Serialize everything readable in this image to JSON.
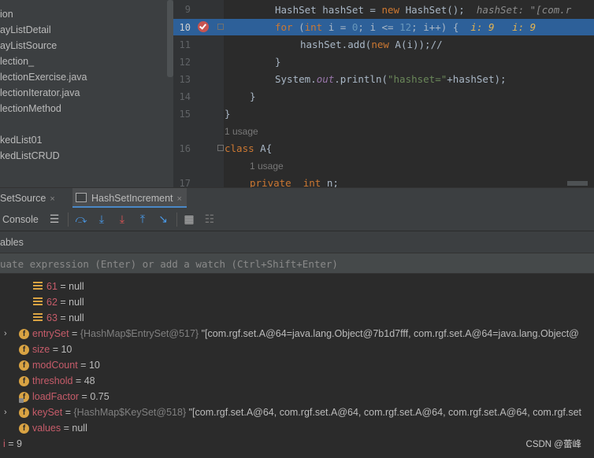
{
  "project_tree": {
    "items": [
      "ion",
      "ayListDetail",
      "ayListSource",
      "lection_",
      "lectionExercise.java",
      "lectionIterator.java",
      "lectionMethod",
      "kedList01",
      "kedListCRUD"
    ]
  },
  "editor": {
    "line_numbers": [
      "9",
      "10",
      "11",
      "12",
      "13",
      "14",
      "15",
      "16",
      "17"
    ],
    "line9": {
      "a": "HashSet hashSet = ",
      "kw_new": "new",
      "b": " HashSet();",
      "hint": "hashSet: \"[com.r"
    },
    "line10": {
      "kw_for": "for",
      "p1": " (",
      "kw_int": "int",
      "p2": " i = ",
      "n0": "0",
      "p3": "; i <= ",
      "n12": "12",
      "p4": "; i++) {",
      "hint1": "i: 9",
      "hint2": "i: 9"
    },
    "line11": {
      "a": "hashSet.add(",
      "kw_new": "new",
      "b": " A(i));//"
    },
    "line12": "}",
    "line13": {
      "a": "System.",
      "out": "out",
      "b": ".println(",
      "str": "\"hashset=\"",
      "c": "+hashSet);"
    },
    "line14": "}",
    "line15": "}",
    "usage1": "1 usage",
    "line16": {
      "kw": "class",
      "b": " A{"
    },
    "usage2": "1 usage",
    "line17": {
      "kw_private": "private",
      "kw_int": "int",
      "n": "n;"
    }
  },
  "debug_tabs": {
    "tab1": "SetSource",
    "tab2": "HashSetIncrement",
    "close": "×"
  },
  "debug_toolbar": {
    "console": "Console",
    "icons": [
      "menu-icon",
      "step-over-icon",
      "step-into-icon",
      "force-step-into-icon",
      "step-out-icon",
      "run-to-cursor-icon",
      "evaluate-icon",
      "trace-icon"
    ]
  },
  "variables": {
    "header": "ables",
    "eval_placeholder": "uate expression (Enter) or add a watch (Ctrl+Shift+Enter)",
    "rows": [
      {
        "name": "61",
        "value": "null"
      },
      {
        "name": "62",
        "value": "null"
      },
      {
        "name": "63",
        "value": "null"
      },
      {
        "name": "entrySet",
        "type": "{HashMap$EntrySet@517}",
        "value": "\"[com.rgf.set.A@64=java.lang.Object@7b1d7fff, com.rgf.set.A@64=java.lang.Object@"
      },
      {
        "name": "size",
        "value": "10"
      },
      {
        "name": "modCount",
        "value": "10"
      },
      {
        "name": "threshold",
        "value": "48"
      },
      {
        "name": "loadFactor",
        "value": "0.75"
      },
      {
        "name": "keySet",
        "type": "{HashMap$KeySet@518}",
        "value": "\"[com.rgf.set.A@64, com.rgf.set.A@64, com.rgf.set.A@64, com.rgf.set.A@64, com.rgf.set"
      },
      {
        "name": "values",
        "value": "null"
      },
      {
        "name": "i",
        "value": "9"
      }
    ],
    "eq": " = "
  },
  "watermark": "CSDN @蕾峰",
  "colors": {
    "highlight": "#2d6099",
    "keyword": "#cc7832",
    "number": "#6897bb",
    "string": "#6a8759",
    "field": "#d9a343"
  }
}
